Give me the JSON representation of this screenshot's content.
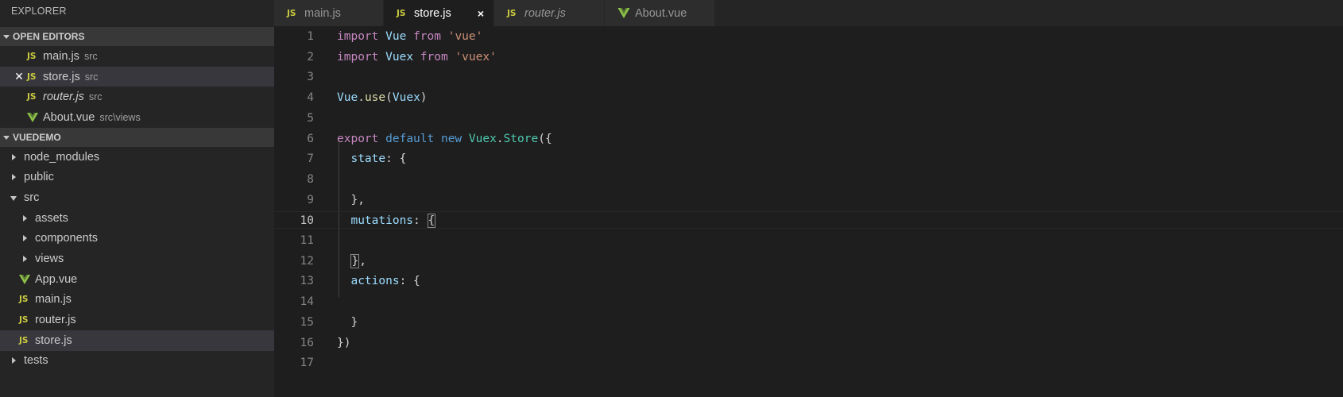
{
  "sidebar": {
    "title": "EXPLORER",
    "open_editors": {
      "header": "OPEN EDITORS",
      "items": [
        {
          "icon": "JS",
          "name": "main.js",
          "desc": "src"
        },
        {
          "icon": "JS",
          "name": "store.js",
          "desc": "src"
        },
        {
          "icon": "JS",
          "name": "router.js",
          "desc": "src"
        },
        {
          "icon": "vue",
          "name": "About.vue",
          "desc": "src\\views"
        }
      ]
    },
    "project": {
      "header": "VUEDEMO",
      "items": [
        {
          "name": "node_modules"
        },
        {
          "name": "public"
        },
        {
          "name": "src"
        },
        {
          "name": "assets"
        },
        {
          "name": "components"
        },
        {
          "name": "views"
        },
        {
          "icon": "vue",
          "name": "App.vue"
        },
        {
          "icon": "JS",
          "name": "main.js"
        },
        {
          "icon": "JS",
          "name": "router.js"
        },
        {
          "icon": "JS",
          "name": "store.js"
        },
        {
          "name": "tests"
        }
      ]
    }
  },
  "tabs": [
    {
      "icon": "JS",
      "label": "main.js"
    },
    {
      "icon": "JS",
      "label": "store.js",
      "close": "×"
    },
    {
      "icon": "JS",
      "label": "router.js"
    },
    {
      "icon": "vue",
      "label": "About.vue"
    }
  ],
  "editor": {
    "line_numbers": [
      "1",
      "2",
      "3",
      "4",
      "5",
      "6",
      "7",
      "8",
      "9",
      "10",
      "11",
      "12",
      "13",
      "14",
      "15",
      "16",
      "17"
    ],
    "lines": [
      [
        "import",
        " ",
        "Vue",
        " ",
        "from",
        " ",
        "'vue'"
      ],
      [
        "import",
        " ",
        "Vuex",
        " ",
        "from",
        " ",
        "'vuex'"
      ],
      [],
      [
        "Vue",
        ".",
        "use",
        "(",
        "Vuex",
        ")"
      ],
      [],
      [
        "export",
        " ",
        "default",
        " ",
        "new",
        " ",
        "Vuex",
        ".",
        "Store",
        "({"
      ],
      [
        "  ",
        "state",
        ": {"
      ],
      [],
      [
        "  },"
      ],
      [
        "  ",
        "mutations",
        ": ",
        "{"
      ],
      [],
      [
        "  ",
        "}",
        ","
      ],
      [
        "  ",
        "actions",
        ": {"
      ],
      [],
      [
        "  }"
      ],
      [
        "})"
      ],
      []
    ]
  },
  "colors": {
    "keyword": "#c586c0",
    "string": "#ce9178",
    "variable": "#9cdcfe",
    "class": "#4ec9b0",
    "function": "#dcdcaa",
    "js_icon": "#cbcb41",
    "vue_icon": "#8dc149"
  }
}
